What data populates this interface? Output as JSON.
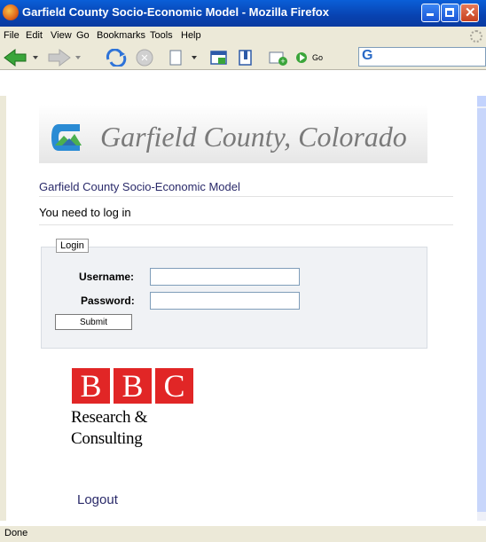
{
  "window": {
    "title": "Garfield County Socio-Economic Model - Mozilla Firefox"
  },
  "menu": {
    "items": [
      "File",
      "Edit",
      "View",
      "Go",
      "Bookmarks",
      "Tools",
      "Help"
    ]
  },
  "toolbar": {
    "go_label": "Go",
    "search_engine_letter": "G"
  },
  "page": {
    "banner_title": "Garfield County, Colorado",
    "site_title": "Garfield County Socio-Economic Model",
    "login_message": "You need to log in",
    "login_legend": "Login",
    "username_label": "Username:",
    "password_label": "Password:",
    "username_value": "",
    "password_value": "",
    "submit_label": "Submit",
    "logo_letters": [
      "B",
      "B",
      "C"
    ],
    "logo_line1": "Research &",
    "logo_line2": "Consulting",
    "logout_label": "Logout"
  },
  "status": {
    "text": "Done"
  },
  "colors": {
    "brand_red": "#e12626",
    "link_blue": "#2a2a6a",
    "titlebar_blue": "#0842b0"
  }
}
